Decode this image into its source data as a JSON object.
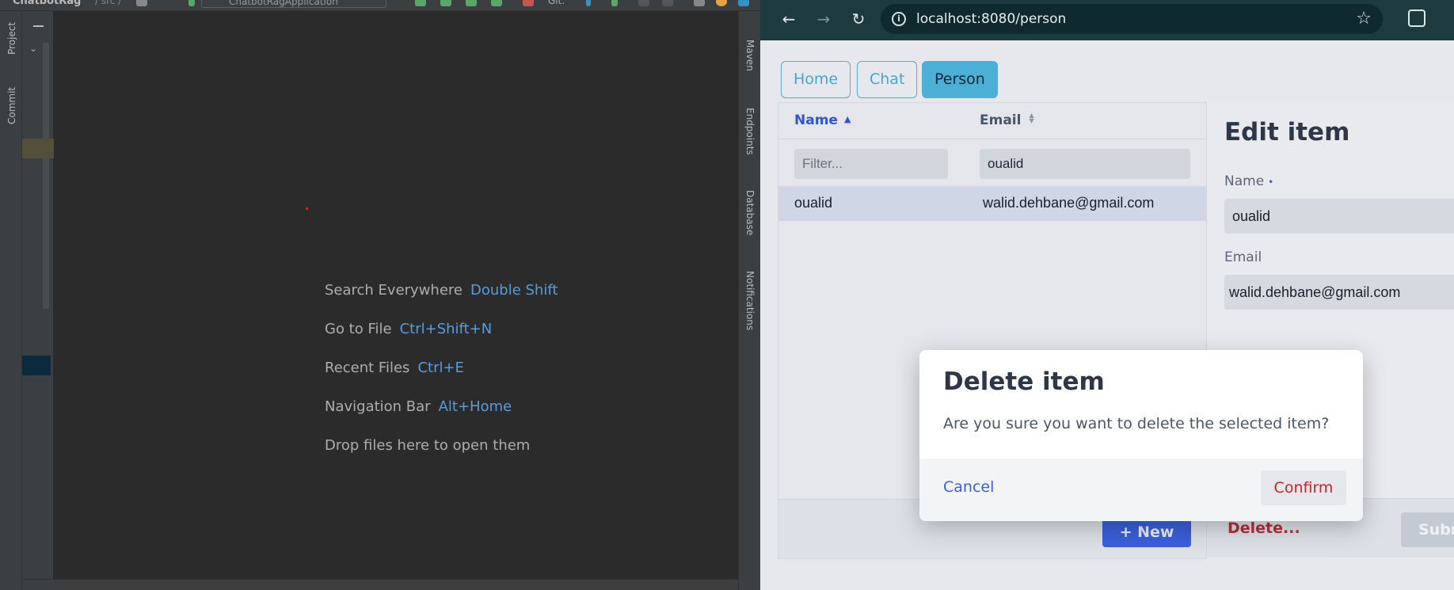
{
  "ide": {
    "project_name": "ChatbotRag",
    "breadcrumb": "/ src /",
    "run_config": "ChatbotRagApplication",
    "git_label": "Git:",
    "left_tabs": [
      "Project",
      "Commit"
    ],
    "right_tabs": [
      "Maven",
      "Endpoints",
      "Database",
      "Notifications"
    ],
    "hints": [
      {
        "label": "Search Everywhere",
        "key": "Double Shift"
      },
      {
        "label": "Go to File",
        "key": "Ctrl+Shift+N"
      },
      {
        "label": "Recent Files",
        "key": "Ctrl+E"
      },
      {
        "label": "Navigation Bar",
        "key": "Alt+Home"
      },
      {
        "label": "Drop files here to open them",
        "key": ""
      }
    ],
    "colors": {
      "background": "#2b2b2b",
      "panel": "#3c3f41",
      "key_accent": "#5a9bdb"
    }
  },
  "browser": {
    "url": "localhost:8080/person",
    "nav": {
      "back": "←",
      "forward": "→",
      "reload": "↻",
      "star": "☆"
    },
    "app_nav": [
      "Home",
      "Chat",
      "Person"
    ],
    "active_nav": "Person",
    "grid": {
      "columns": [
        "Name",
        "Email"
      ],
      "name_filter_placeholder": "Filter...",
      "email_filter_value": "oualid",
      "rows": [
        {
          "name": "oualid",
          "email": "walid.dehbane@gmail.com"
        }
      ],
      "new_button": "+ New"
    },
    "edit": {
      "title": "Edit item",
      "name_label": "Name",
      "name_required_marker": "•",
      "name_value": "oualid",
      "email_label": "Email",
      "email_value": "walid.dehbane@gmail.com",
      "delete_label": "Delete...",
      "submit_label": "Submit"
    },
    "dialog": {
      "title": "Delete item",
      "message": "Are you sure you want to delete the selected item?",
      "cancel": "Cancel",
      "confirm": "Confirm"
    },
    "colors": {
      "chrome": "#1d3a3f",
      "primary": "#3b5fd9",
      "nav_accent": "#4cb0d6",
      "danger": "#c0262d"
    }
  }
}
